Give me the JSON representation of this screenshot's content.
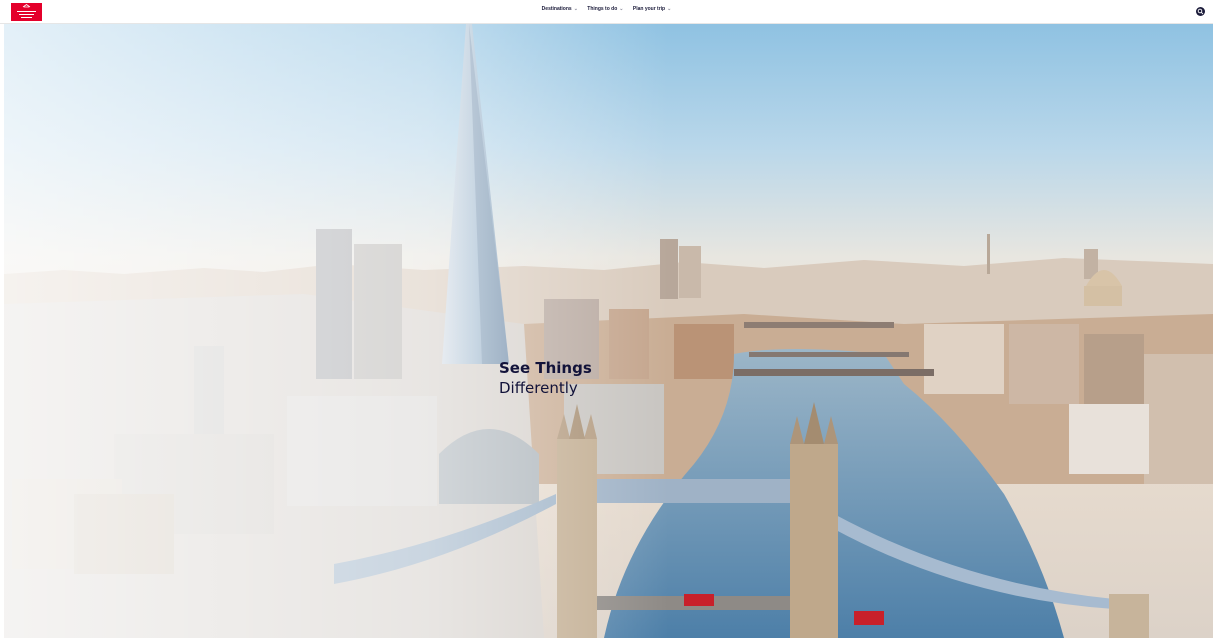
{
  "header": {
    "logo_text": "VISIT BRITAIN",
    "logo_icon": "union-jack-crown-logo",
    "nav": [
      {
        "label": "Destinations"
      },
      {
        "label": "Things to do"
      },
      {
        "label": "Plan your trip"
      }
    ],
    "search_icon": "search-icon"
  },
  "hero": {
    "headline_line1": "See Things",
    "headline_line2": "Differently",
    "image": "aerial-london-skyline-tower-bridge-shard"
  },
  "colors": {
    "brand_red": "#e4002b",
    "navy": "#12133a",
    "sky_top": "#8fc2e2",
    "haze": "#f3ebe3",
    "river": "#5f8fb4"
  }
}
